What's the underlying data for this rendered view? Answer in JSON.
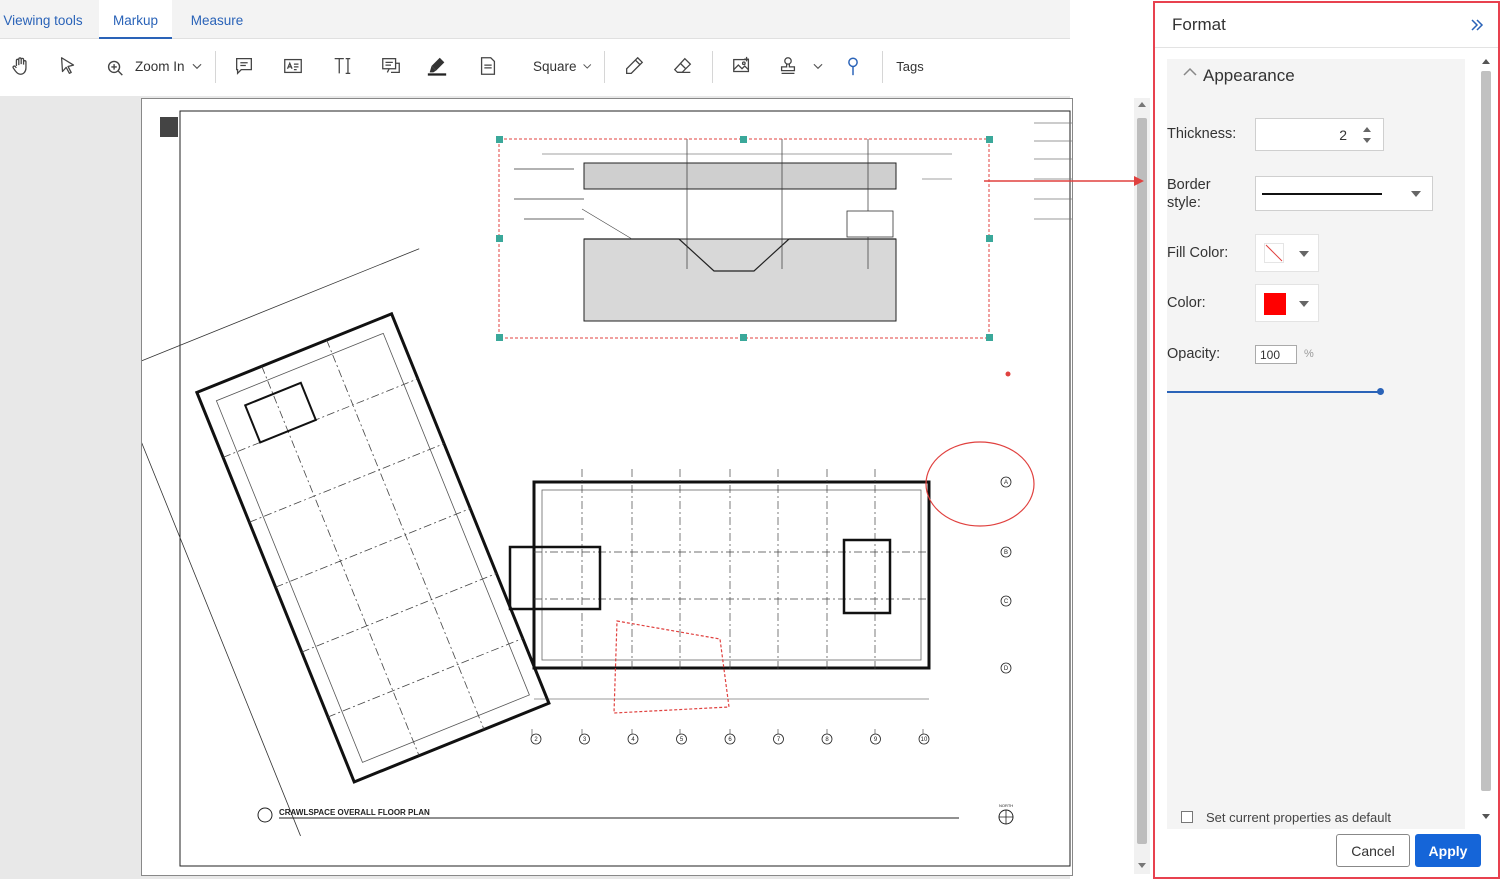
{
  "tabs": [
    {
      "label": "Viewing tools",
      "active": false
    },
    {
      "label": "Markup",
      "active": true
    },
    {
      "label": "Measure",
      "active": false
    }
  ],
  "toolbar": {
    "zoom_label": "Zoom In",
    "shape_label": "Square",
    "tags_label": "Tags"
  },
  "drawing": {
    "title": "CRAWLSPACE OVERALL FLOOR PLAN",
    "grid_numbers": [
      "2",
      "3",
      "4",
      "5",
      "6",
      "7",
      "8",
      "9",
      "10"
    ],
    "grid_letters": [
      "A",
      "B",
      "C",
      "D"
    ],
    "north_label": "NORTH"
  },
  "panel": {
    "title": "Format",
    "section": "Appearance",
    "thickness_label": "Thickness:",
    "thickness_value": "2",
    "border_style_label_1": "Border",
    "border_style_label_2": "style:",
    "fill_color_label": "Fill Color:",
    "color_label": "Color:",
    "color_value": "#ff0000",
    "opacity_label": "Opacity:",
    "opacity_value": "100",
    "opacity_unit": "%",
    "opacity_fraction": 1.0,
    "default_checkbox_label": "Set current properties as default",
    "cancel_label": "Cancel",
    "apply_label": "Apply"
  },
  "colors": {
    "accent": "#2a63b8",
    "markup_red": "#e0413f",
    "apply_bg": "#1565d8",
    "panel_border": "#e8414f"
  }
}
